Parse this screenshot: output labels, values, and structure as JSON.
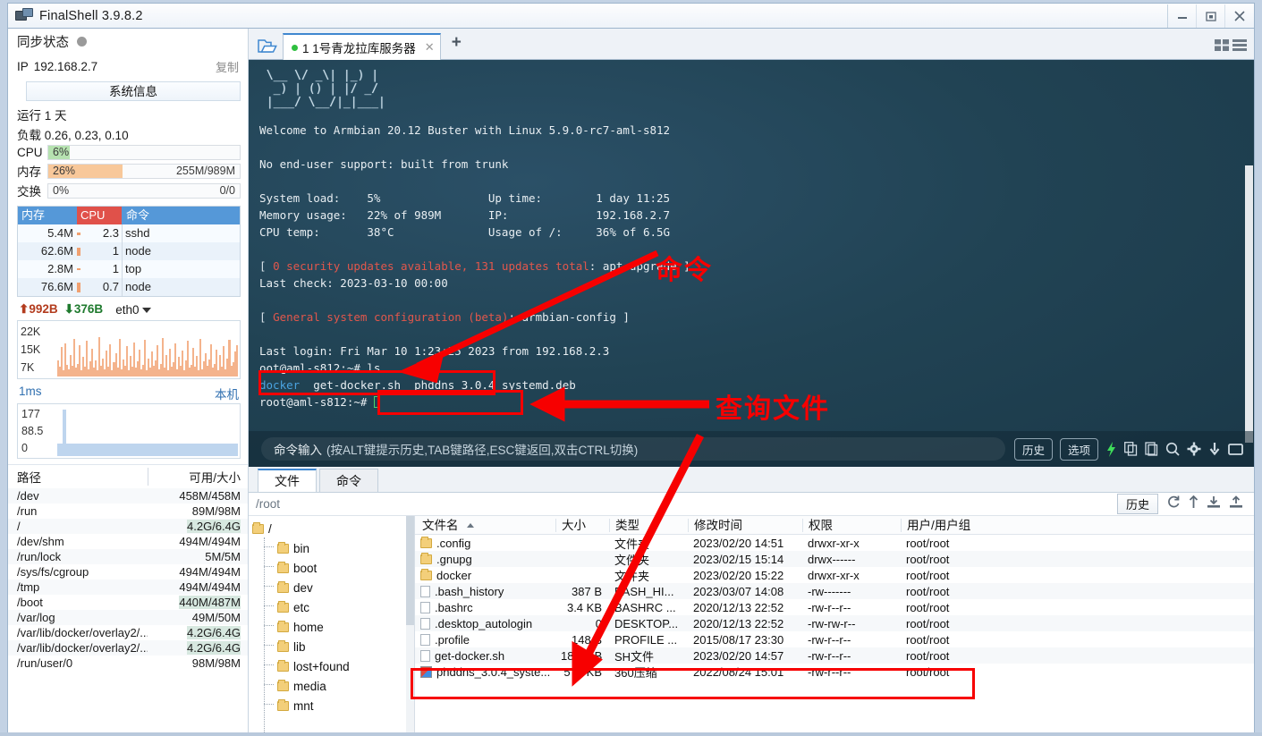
{
  "window": {
    "title": "FinalShell 3.9.8.2",
    "app_icon": "monitor-icon",
    "minimize": "–",
    "restore": "❐",
    "close": "✕"
  },
  "sidebar": {
    "sync_label": "同步状态",
    "ip_label": "IP",
    "ip_value": "192.168.2.7",
    "copy_label": "复制",
    "sysinfo_button": "系统信息",
    "uptime": "运行 1 天",
    "load": "负载 0.26, 0.23, 0.10",
    "meters": [
      {
        "label": "CPU",
        "pct": "6%",
        "amount": "",
        "fill_color": "#b6e2b0",
        "width": "11%"
      },
      {
        "label": "内存",
        "pct": "26%",
        "amount": "255M/989M",
        "fill_color": "#f8c89a",
        "width": "39%"
      },
      {
        "label": "交换",
        "pct": "0%",
        "amount": "0/0",
        "fill_color": "#f8c89a",
        "width": "0%"
      }
    ],
    "process_table": {
      "headers": [
        "内存",
        "CPU",
        "命令"
      ],
      "rows": [
        {
          "mem": "5.4M",
          "cpu": "2.3",
          "cmd": "sshd",
          "bar": 3
        },
        {
          "mem": "62.6M",
          "cpu": "1",
          "cmd": "node",
          "bar": 9
        },
        {
          "mem": "2.8M",
          "cpu": "1",
          "cmd": "top",
          "bar": 2
        },
        {
          "mem": "76.6M",
          "cpu": "0.7",
          "cmd": "node",
          "bar": 11
        }
      ]
    },
    "net": {
      "up": "992B",
      "down": "376B",
      "interface": "eth0",
      "y_labels": [
        "22K",
        "15K",
        "7K"
      ]
    },
    "latency": {
      "unit": "1ms",
      "local": "本机",
      "y_labels": [
        "177",
        "88.5",
        "0"
      ]
    },
    "disk": {
      "headers": [
        "路径",
        "可用/大小"
      ],
      "rows": [
        {
          "path": "/dev",
          "size": "458M/458M",
          "hl": false
        },
        {
          "path": "/run",
          "size": "89M/98M",
          "hl": false
        },
        {
          "path": "/",
          "size": "4.2G/6.4G",
          "hl": true
        },
        {
          "path": "/dev/shm",
          "size": "494M/494M",
          "hl": false
        },
        {
          "path": "/run/lock",
          "size": "5M/5M",
          "hl": false
        },
        {
          "path": "/sys/fs/cgroup",
          "size": "494M/494M",
          "hl": false
        },
        {
          "path": "/tmp",
          "size": "494M/494M",
          "hl": false
        },
        {
          "path": "/boot",
          "size": "440M/487M",
          "hl": true
        },
        {
          "path": "/var/log",
          "size": "49M/50M",
          "hl": false
        },
        {
          "path": "/var/lib/docker/overlay2/...",
          "size": "4.2G/6.4G",
          "hl": true
        },
        {
          "path": "/var/lib/docker/overlay2/...",
          "size": "4.2G/6.4G",
          "hl": true
        },
        {
          "path": "/run/user/0",
          "size": "98M/98M",
          "hl": false
        }
      ]
    }
  },
  "tabbar": {
    "folder_icon": "open-folder-icon",
    "tab_label": "1 1号青龙拉库服务器",
    "tab_close": "✕",
    "new_tab": "+",
    "grid_view_icon": "grid-view-icon",
    "list_view_icon": "list-view-icon"
  },
  "terminal": {
    "banner": " \\__ \\/ _\\| |_) |\n  _) | () | |/ _/\n |___/ \\__/|_|___|",
    "lines": [
      "Welcome to Armbian 20.12 Buster with Linux 5.9.0-rc7-aml-s812",
      "",
      "No end-user support: built from trunk",
      ""
    ],
    "stats": [
      {
        "k": "System load:",
        "v": "5%",
        "k2": "Up time:",
        "v2": "1 day 11:25"
      },
      {
        "k": "Memory usage:",
        "v": "22% of 989M",
        "k2": "IP:",
        "v2": "192.168.2.7"
      },
      {
        "k": "CPU temp:",
        "v": "38°C",
        "k2": "Usage of /:",
        "v2": "36% of 6.5G"
      }
    ],
    "update_line_a": "0 security updates available, 131 updates total",
    "update_line_b": ": apt upgrade ]",
    "last_check": "Last check: 2023-03-10 00:00",
    "config_line": "General system configuration (beta)",
    "config_line_b": ": armbian-config ]",
    "last_login": "Last login: Fri Mar 10 1:23:25 2023 from 192.168.2.3",
    "prompt1": "oot@aml-s812:~# ls",
    "ls_out_docker": "docker",
    "ls_out_sh": "get-docker.sh",
    "ls_out_deb": "phddns_3.0.4_systemd.deb",
    "prompt2": "root@aml-s812:~# "
  },
  "cmdbar": {
    "placeholder_main": "命令输入",
    "placeholder_hint": "(按ALT键提示历史,TAB键路径,ESC键返回,双击CTRL切换)",
    "history_button": "历史",
    "options_button": "选项",
    "icons": [
      "lightning-icon",
      "copy-icon",
      "paste-icon",
      "search-icon",
      "gear-icon",
      "download-icon",
      "window-icon"
    ]
  },
  "filepanel": {
    "tabs": [
      {
        "label": "文件",
        "active": true
      },
      {
        "label": "命令",
        "active": false
      }
    ],
    "path": "/root",
    "history_button": "历史",
    "tool_icons": [
      "refresh-icon",
      "up-arrow-icon",
      "download-icon",
      "upload-icon"
    ],
    "tree": {
      "root": "/",
      "children": [
        "bin",
        "boot",
        "dev",
        "etc",
        "home",
        "lib",
        "lost+found",
        "media",
        "mnt"
      ]
    },
    "list": {
      "headers": [
        "文件名",
        "大小",
        "类型",
        "修改时间",
        "权限",
        "用户/用户组"
      ],
      "rows": [
        {
          "icon": "folder",
          "name": ".config",
          "size": "",
          "type": "文件夹",
          "mtime": "2023/02/20 14:51",
          "perm": "drwxr-xr-x",
          "owner": "root/root"
        },
        {
          "icon": "folder",
          "name": ".gnupg",
          "size": "",
          "type": "文件夹",
          "mtime": "2023/02/15 15:14",
          "perm": "drwx------",
          "owner": "root/root"
        },
        {
          "icon": "folder",
          "name": "docker",
          "size": "",
          "type": "文件夹",
          "mtime": "2023/02/20 15:22",
          "perm": "drwxr-xr-x",
          "owner": "root/root"
        },
        {
          "icon": "file",
          "name": ".bash_history",
          "size": "387 B",
          "type": "BASH_HI...",
          "mtime": "2023/03/07 14:08",
          "perm": "-rw-------",
          "owner": "root/root"
        },
        {
          "icon": "file",
          "name": ".bashrc",
          "size": "3.4 KB",
          "type": "BASHRC ...",
          "mtime": "2020/12/13 22:52",
          "perm": "-rw-r--r--",
          "owner": "root/root"
        },
        {
          "icon": "file",
          "name": ".desktop_autologin",
          "size": "0",
          "type": "DESKTOP...",
          "mtime": "2020/12/13 22:52",
          "perm": "-rw-rw-r--",
          "owner": "root/root"
        },
        {
          "icon": "file",
          "name": ".profile",
          "size": "148 B",
          "type": "PROFILE ...",
          "mtime": "2015/08/17 23:30",
          "perm": "-rw-r--r--",
          "owner": "root/root"
        },
        {
          "icon": "file",
          "name": "get-docker.sh",
          "size": "18.5 KB",
          "type": "SH文件",
          "mtime": "2023/02/20 14:57",
          "perm": "-rw-r--r--",
          "owner": "root/root"
        },
        {
          "icon": "zip",
          "name": "phddns_3.0.4_syste...",
          "size": "573 KB",
          "type": "360压缩",
          "mtime": "2022/08/24 15:01",
          "perm": "-rw-r--r--",
          "owner": "root/root"
        }
      ]
    }
  },
  "annotations": [
    {
      "text": "命令",
      "color": "#f70000"
    },
    {
      "text": "查询文件",
      "color": "#f70000"
    }
  ]
}
